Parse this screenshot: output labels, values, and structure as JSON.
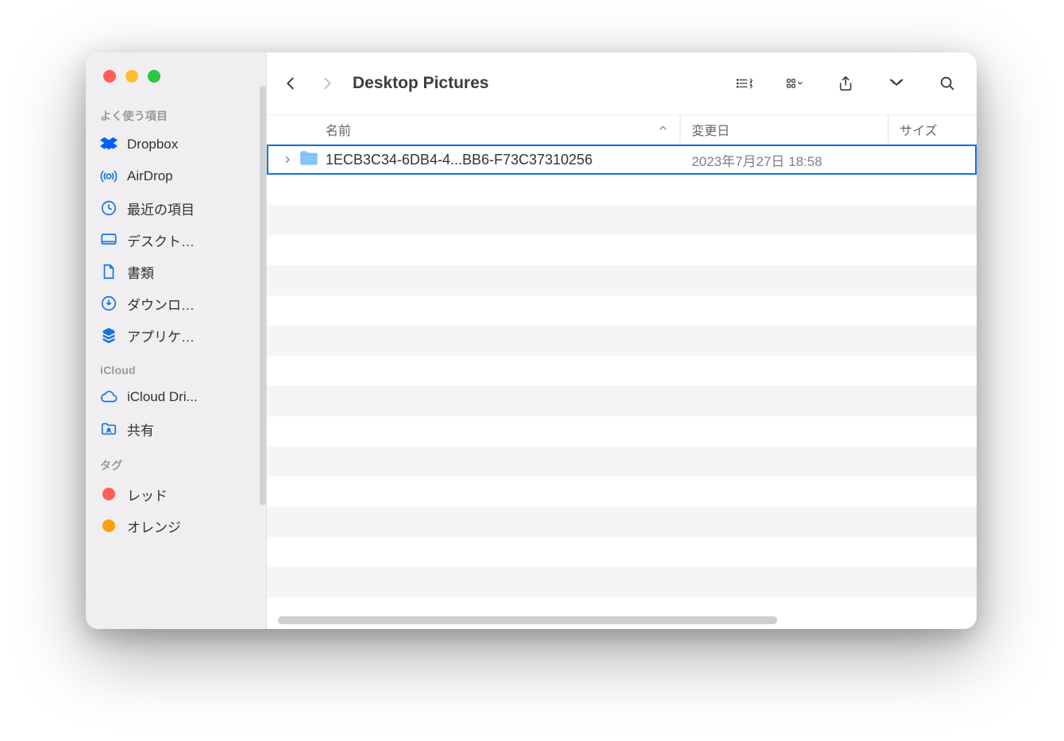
{
  "window": {
    "title": "Desktop Pictures"
  },
  "sidebar": {
    "sections": [
      {
        "header": "よく使う項目",
        "items": [
          {
            "icon": "dropbox-icon",
            "label": "Dropbox"
          },
          {
            "icon": "airdrop-icon",
            "label": "AirDrop"
          },
          {
            "icon": "recents-icon",
            "label": "最近の項目"
          },
          {
            "icon": "desktop-icon",
            "label": "デスクト…"
          },
          {
            "icon": "documents-icon",
            "label": "書類"
          },
          {
            "icon": "downloads-icon",
            "label": "ダウンロ…"
          },
          {
            "icon": "apps-icon",
            "label": "アプリケ…"
          }
        ]
      },
      {
        "header": "iCloud",
        "items": [
          {
            "icon": "cloud-icon",
            "label": "iCloud Dri..."
          },
          {
            "icon": "shared-folder-icon",
            "label": "共有"
          }
        ]
      },
      {
        "header": "タグ",
        "items": [
          {
            "icon": "tag-red-icon",
            "label": "レッド",
            "dot": "#ff5f57"
          },
          {
            "icon": "tag-orange-icon",
            "label": "オレンジ",
            "dot": "#ff9f0a"
          }
        ]
      }
    ]
  },
  "columns": {
    "name": "名前",
    "date": "変更日",
    "size": "サイズ"
  },
  "sort": {
    "column": "name",
    "direction": "asc"
  },
  "rows": [
    {
      "name": "1ECB3C34-6DB4-4...BB6-F73C37310256",
      "modified": "2023年7月27日 18:58",
      "size": "",
      "kind": "folder",
      "selected": true
    }
  ],
  "colors": {
    "accent": "#1173e2",
    "sidebar_icon": "#1173e2",
    "dropbox": "#0061ff"
  }
}
